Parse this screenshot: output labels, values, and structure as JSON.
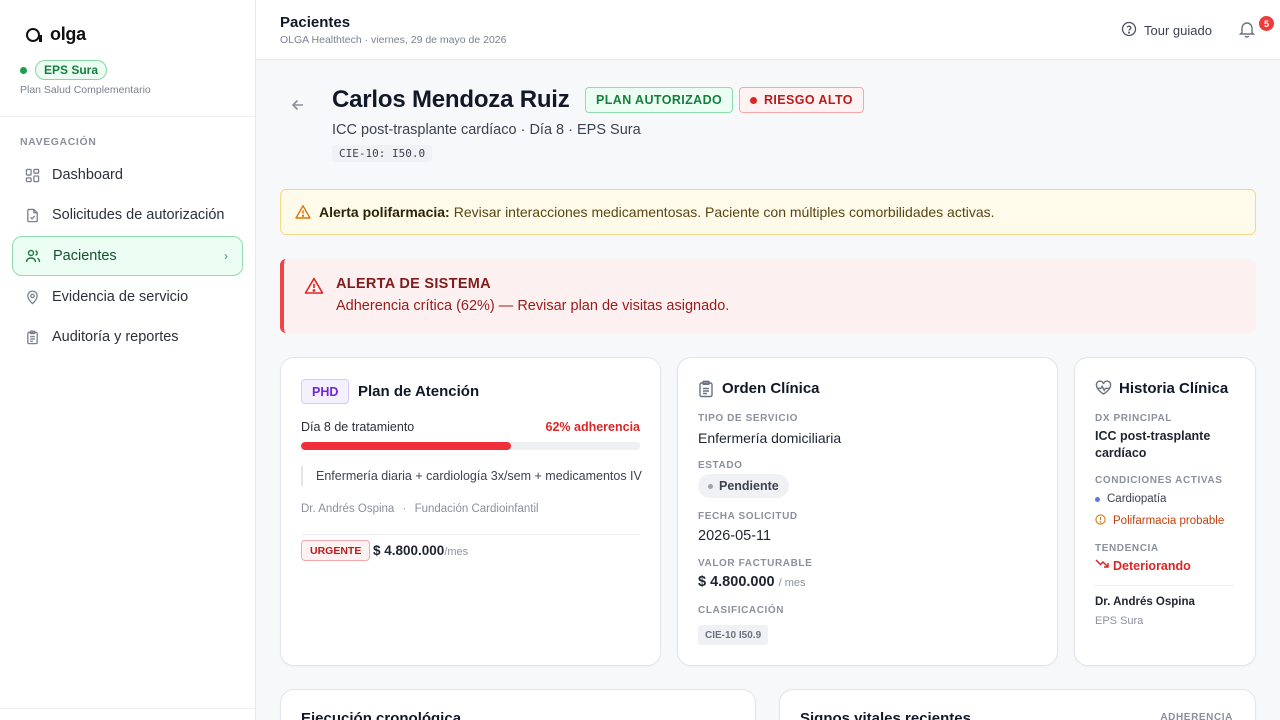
{
  "brand": {
    "name": "olga"
  },
  "eps": {
    "label": "EPS Sura",
    "plan": "Plan Salud Complementario"
  },
  "nav": {
    "heading": "NAVEGACIÓN",
    "items": [
      {
        "label": "Dashboard",
        "icon": "grid-icon"
      },
      {
        "label": "Solicitudes de autorización",
        "icon": "file-check-icon"
      },
      {
        "label": "Pacientes",
        "icon": "users-icon",
        "active": true
      },
      {
        "label": "Evidencia de servicio",
        "icon": "map-pin-icon"
      },
      {
        "label": "Auditoría y reportes",
        "icon": "clipboard-icon"
      }
    ]
  },
  "topbar": {
    "title": "Pacientes",
    "subtitle": "OLGA Healthtech · viernes, 29 de mayo de 2026",
    "tour_label": "Tour guiado",
    "notifications": "5"
  },
  "patient": {
    "name": "Carlos Mendoza Ruiz",
    "plan_badge": "PLAN AUTORIZADO",
    "risk_badge": "RIESGO ALTO",
    "subtitle": "ICC post-trasplante cardíaco · Día 8 · EPS Sura",
    "cie": "CIE-10: I50.0"
  },
  "alert_poly": {
    "title": "Alerta polifarmacia:",
    "text": "Revisar interacciones medicamentosas. Paciente con múltiples comorbilidades activas."
  },
  "alert_system": {
    "title": "ALERTA DE SISTEMA",
    "text": "Adherencia crítica (62%) — Revisar plan de visitas asignado."
  },
  "plan_card": {
    "tag": "PHD",
    "title": "Plan de Atención",
    "day_label": "Día 8 de tratamiento",
    "adherence_label": "62% adherencia",
    "adherence_fraction": 0.62,
    "description": "Enfermería diaria + cardiología 3x/sem + medicamentos IV",
    "doctor": "Dr. Andrés Ospina",
    "separator": "·",
    "institution": "Fundación Cardioinfantil",
    "priority": "URGENTE",
    "price": "$ 4.800.000",
    "price_unit": "/mes"
  },
  "order_card": {
    "title": "Orden Clínica",
    "service_label": "TIPO DE SERVICIO",
    "service_value": "Enfermería domiciliaria",
    "status_label": "ESTADO",
    "status_value": "Pendiente",
    "date_label": "FECHA SOLICITUD",
    "date_value": "2026-05-11",
    "billing_label": "VALOR FACTURABLE",
    "billing_value": "$ 4.800.000",
    "billing_unit": "/ mes",
    "class_label": "CLASIFICACIÓN",
    "class_value": "CIE-10 I50.9"
  },
  "history_card": {
    "title": "Historia Clínica",
    "dx_label": "DX PRINCIPAL",
    "dx_value": "ICC post-trasplante cardíaco",
    "conditions_label": "CONDICIONES ACTIVAS",
    "conditions": [
      "Cardiopatía",
      "Polifarmacia probable"
    ],
    "trend_label": "TENDENCIA",
    "trend_value": "Deteriorando",
    "doctor": "Dr. Andrés Ospina",
    "eps": "EPS Sura"
  },
  "bottom": {
    "left_title": "Ejecución cronológica",
    "right_title": "Signos vitales recientes",
    "right_label": "ADHERENCIA"
  },
  "colors": {
    "accent_green": "#16a34a",
    "danger_red": "#dc2626",
    "warning_amber": "#d97706",
    "purple": "#6d28d9"
  }
}
